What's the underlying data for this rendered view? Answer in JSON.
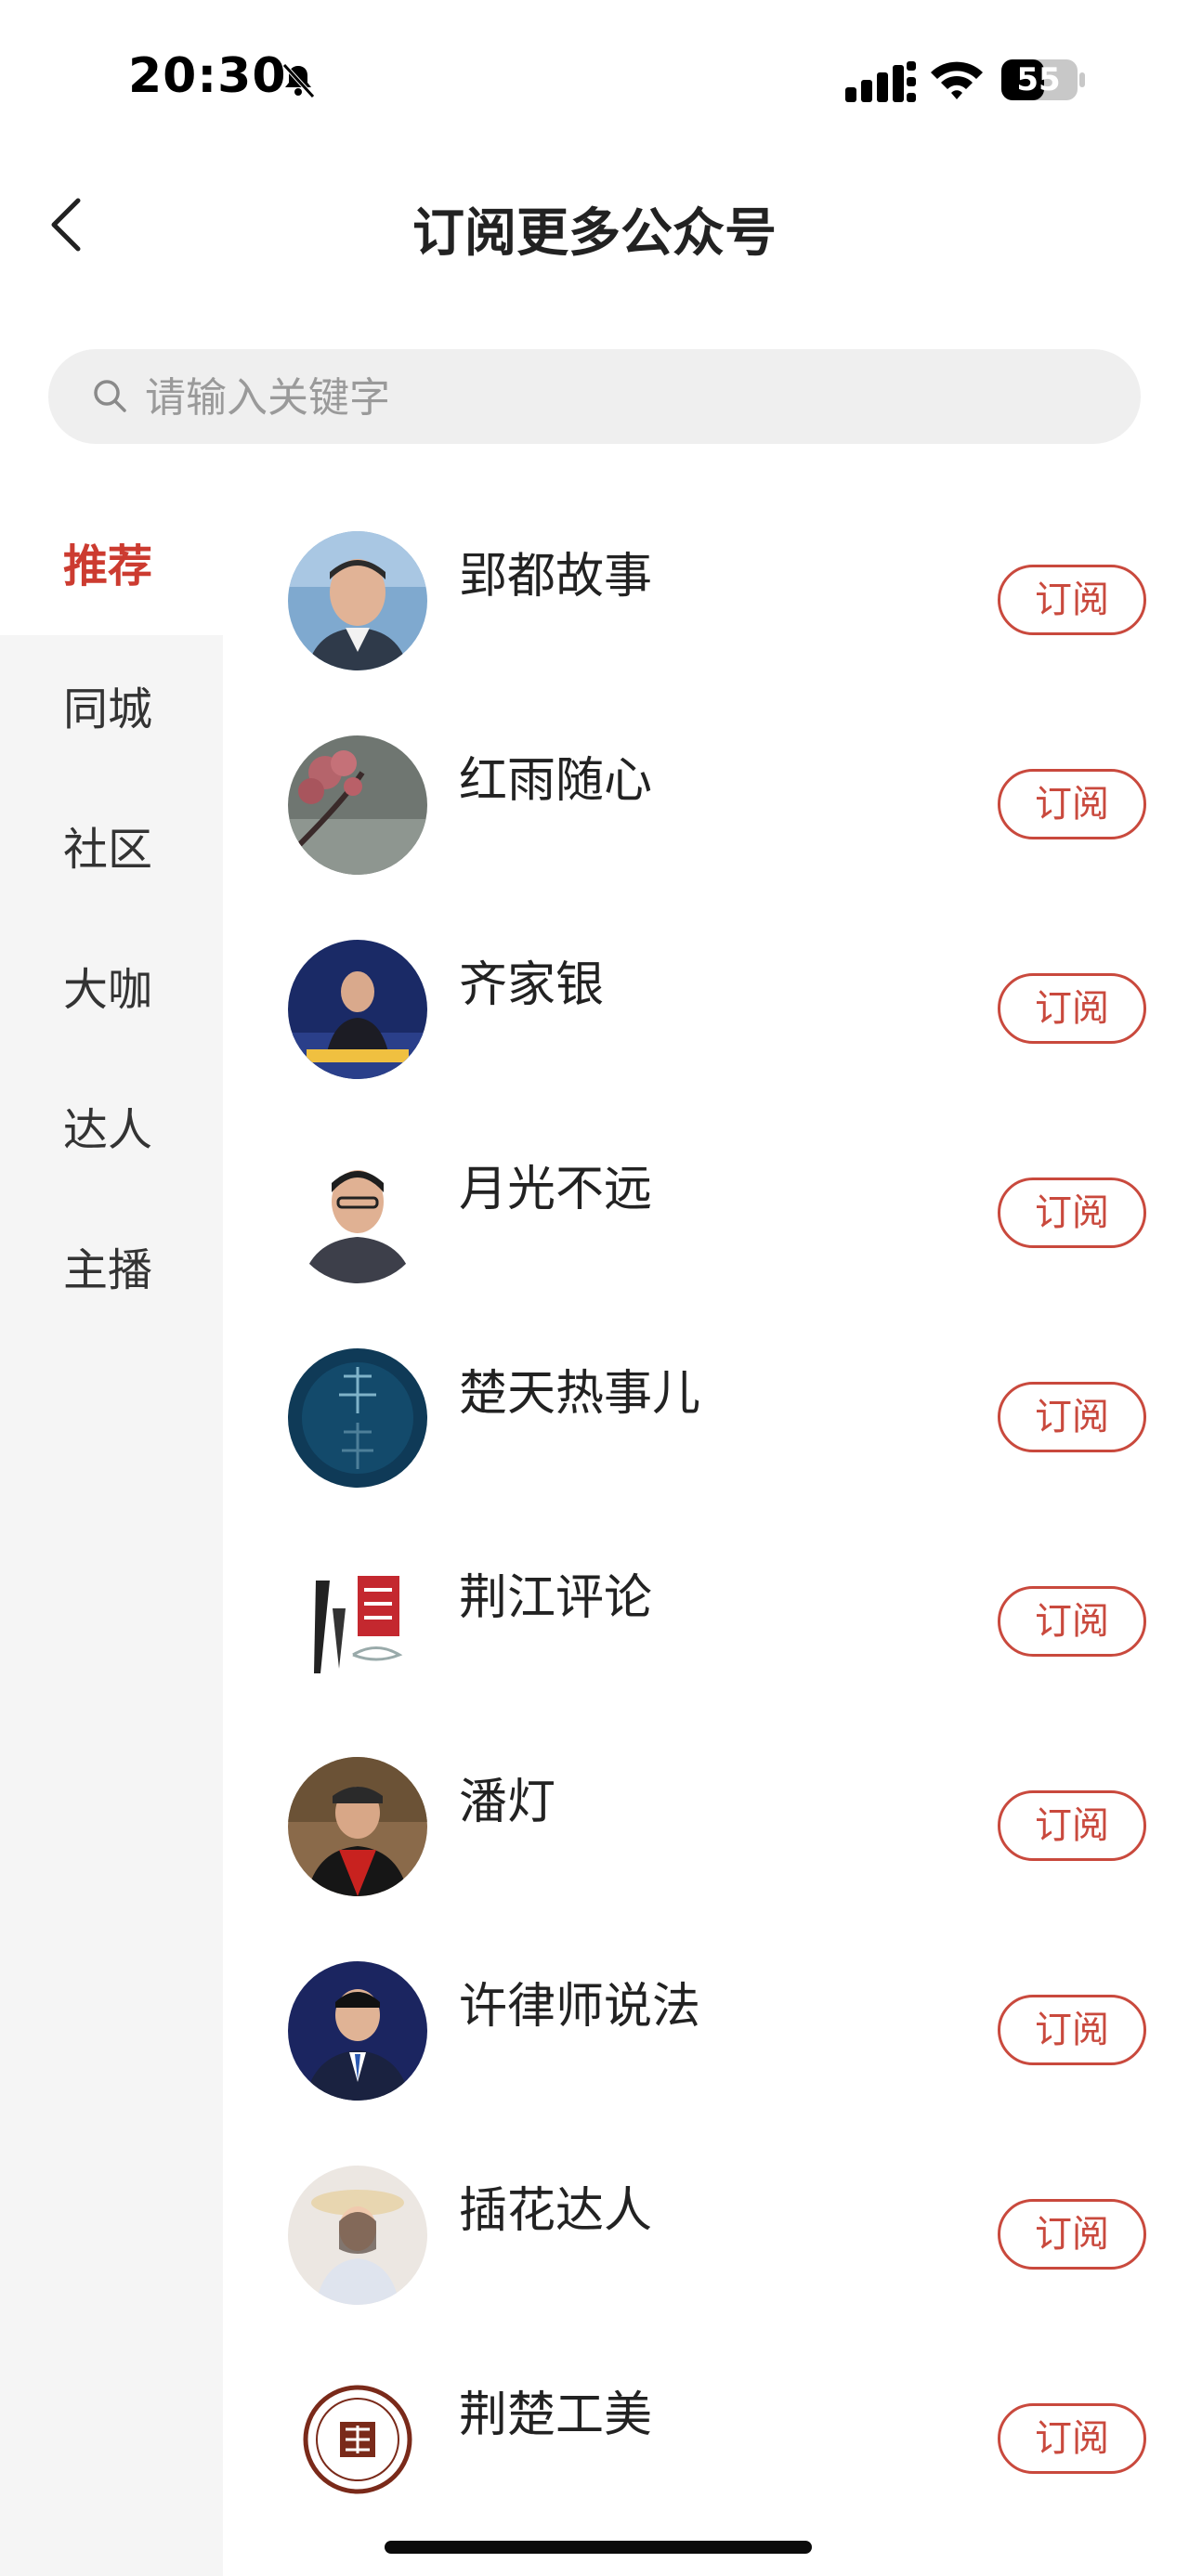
{
  "status_bar": {
    "time": "20:30",
    "battery": "55"
  },
  "nav": {
    "title": "订阅更多公众号"
  },
  "search": {
    "placeholder": "请输入关键字"
  },
  "categories": [
    "推荐",
    "同城",
    "社区",
    "大咖",
    "达人",
    "主播"
  ],
  "accounts": [
    {
      "name": "郢都故事",
      "button": "订阅"
    },
    {
      "name": "红雨随心",
      "button": "订阅"
    },
    {
      "name": "齐家银",
      "button": "订阅"
    },
    {
      "name": "月光不远",
      "button": "订阅"
    },
    {
      "name": "楚天热事儿",
      "button": "订阅"
    },
    {
      "name": "荆江评论",
      "button": "订阅"
    },
    {
      "name": "潘灯",
      "button": "订阅"
    },
    {
      "name": "许律师说法",
      "button": "订阅"
    },
    {
      "name": "插花达人",
      "button": "订阅"
    },
    {
      "name": "荆楚工美",
      "button": "订阅"
    }
  ],
  "colors": {
    "accent": "#c9493d",
    "sidebar_bg": "#f5f5f5",
    "search_bg": "#efefef"
  }
}
